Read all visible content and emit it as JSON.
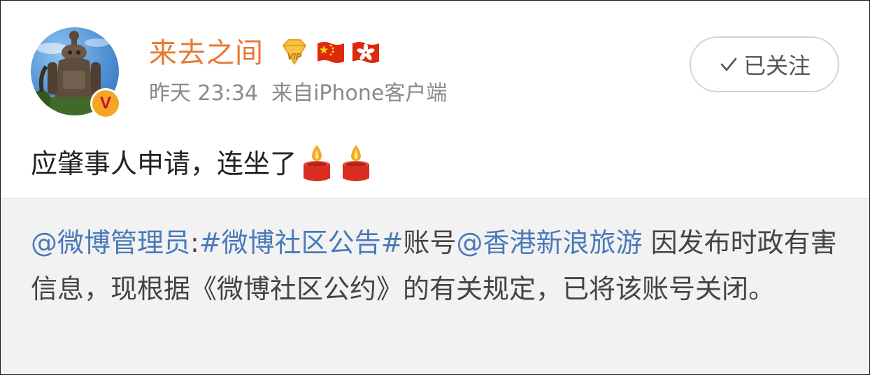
{
  "post": {
    "user": {
      "name": "来去之间",
      "verified_badge": "V",
      "badges": [
        "vip-icon",
        "china-flag-icon",
        "hong-kong-flag-icon"
      ]
    },
    "meta": {
      "time": "昨天 23:34",
      "source": "来自iPhone客户端"
    },
    "follow_button": {
      "label": "已关注",
      "icon": "checkmark-icon"
    },
    "content": {
      "text": "应肇事人申请，连坐了",
      "emoji": [
        "candle-icon",
        "candle-icon"
      ]
    }
  },
  "repost": {
    "mention_admin": "@微博管理员",
    "colon": ":",
    "hashtag": "#微博社区公告#",
    "text_account": "账号",
    "mention_account": "@香港新浪旅游",
    "body": " 因发布时政有害信息，现根据《微博社区公约》的有关规定，已将该账号关闭。"
  },
  "colors": {
    "username": "#e8792f",
    "link": "#4a7ab9",
    "meta": "#8a8a8a",
    "repost_bg": "#f2f2f2",
    "verified_badge": "#f5a623"
  }
}
